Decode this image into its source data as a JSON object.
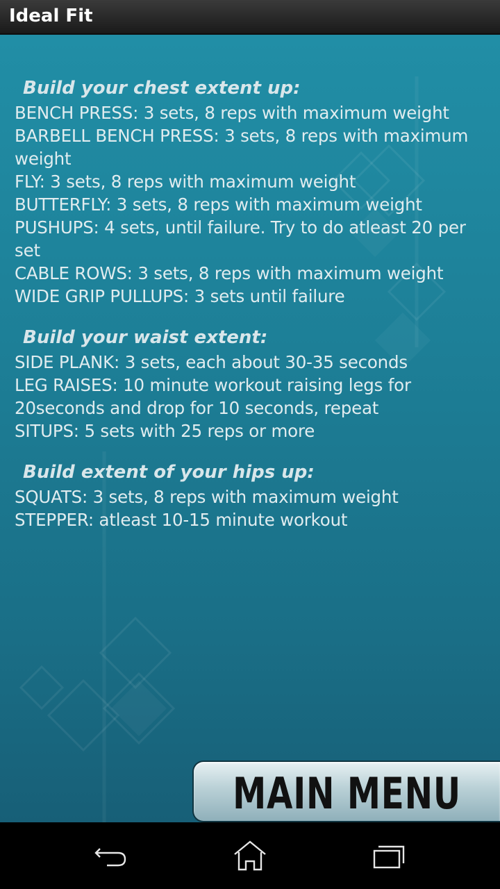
{
  "app": {
    "title": "Ideal Fit"
  },
  "sections": [
    {
      "heading": "Build your chest extent up:",
      "lines": [
        "BENCH PRESS: 3 sets, 8 reps with maximum weight",
        "BARBELL BENCH PRESS: 3 sets, 8 reps with maximum",
        "weight",
        "FLY: 3 sets, 8 reps with maximum weight",
        "BUTTERFLY: 3 sets, 8 reps with maximum weight",
        "PUSHUPS: 4 sets, until failure. Try to do atleast 20 per",
        "set",
        "CABLE ROWS: 3 sets, 8 reps with maximum weight",
        "WIDE GRIP PULLUPS: 3 sets until failure"
      ]
    },
    {
      "heading": "Build your waist extent:",
      "lines": [
        "SIDE PLANK: 3 sets, each about 30-35 seconds",
        "LEG RAISES: 10 minute workout raising legs for",
        "20seconds and drop for 10 seconds, repeat",
        "SITUPS: 5 sets with 25 reps or more"
      ]
    },
    {
      "heading": "Build extent of your hips up:",
      "lines": [
        "SQUATS: 3 sets, 8 reps with maximum weight",
        "STEPPER: atleast 10-15 minute workout"
      ]
    }
  ],
  "main_menu": {
    "label": "MAIN MENU"
  },
  "navbar": {
    "icons": [
      "back-icon",
      "home-icon",
      "recent-apps-icon"
    ]
  }
}
